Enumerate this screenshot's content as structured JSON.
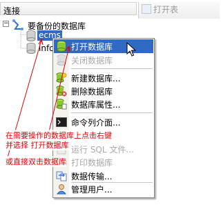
{
  "header": {
    "title": "连接"
  },
  "toolbar": {
    "open_table_label": "打开表"
  },
  "tree": {
    "root_label": "要备份的数据库",
    "db_selected": "ecms",
    "db_second": "info"
  },
  "menu": {
    "items": [
      {
        "label": "打开数据库",
        "state": "selected",
        "icon": "database-open-icon"
      },
      {
        "label": "关闭数据库",
        "state": "disabled",
        "icon": "database-close-icon"
      },
      {
        "label": "新建数据库...",
        "state": "normal",
        "icon": "database-new-icon"
      },
      {
        "label": "删除数据库",
        "state": "normal",
        "icon": "database-delete-icon"
      },
      {
        "label": "数据库属性...",
        "state": "normal",
        "icon": "database-properties-icon"
      },
      {
        "label": "命令列介面...",
        "state": "normal",
        "icon": "console-icon"
      },
      {
        "label": "运行 SQL 文件...",
        "state": "disabled",
        "icon": "run-sql-icon"
      },
      {
        "label": "打印数据库",
        "state": "disabled",
        "icon": "print-icon"
      },
      {
        "label": "数据传输...",
        "state": "normal",
        "icon": "data-transfer-icon"
      },
      {
        "label": "管理用户...",
        "state": "normal",
        "icon": "manage-users-icon"
      }
    ]
  },
  "annotations": {
    "line1": "在需要操作的数据库上点击右键",
    "line2": "并选择 打开数据库",
    "line3": "或直接双击数据库"
  },
  "colors": {
    "selection": "#316ac5",
    "annotation": "#e80000"
  }
}
